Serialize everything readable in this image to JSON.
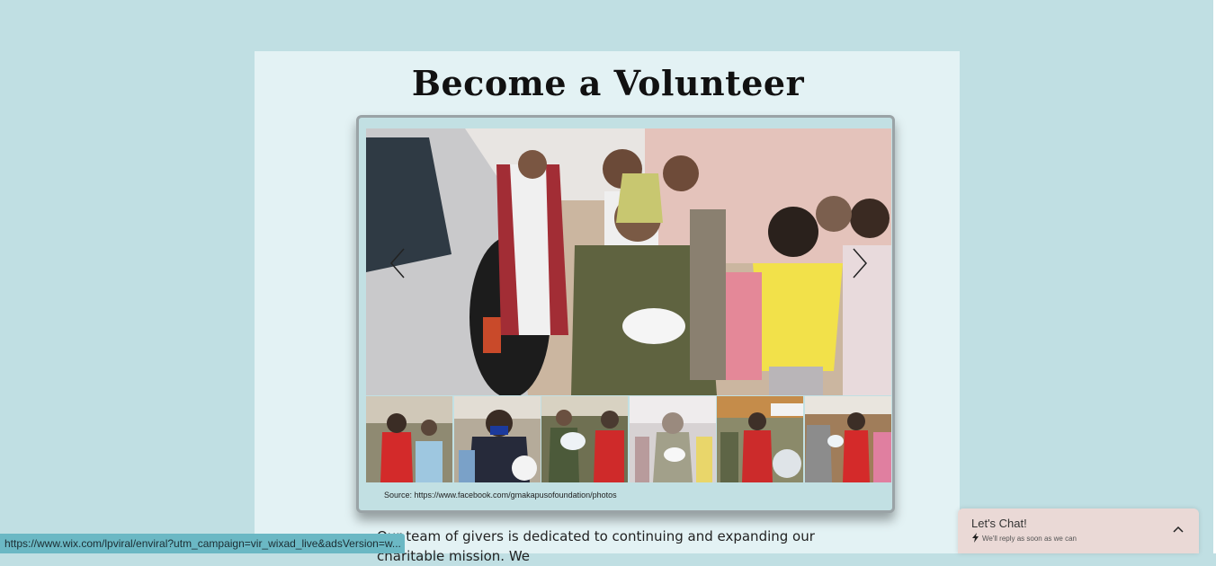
{
  "page": {
    "title": "Become a Volunteer",
    "body_text": "Our team of givers is dedicated to continuing and expanding our charitable mission. We"
  },
  "gallery": {
    "source_text": "Source: https://www.facebook.com/gmakapusofoundation/photos",
    "prev_icon": "chevron-left-icon",
    "next_icon": "chevron-right-icon",
    "thumbnail_count": 6
  },
  "status_bar": {
    "url": "https://www.wix.com/lpviral/enviral?utm_campaign=vir_wixad_live&adsVersion=w..."
  },
  "chat": {
    "title": "Let's Chat!",
    "subtitle": "We'll reply as soon as we can",
    "icon": "lightning-icon",
    "toggle_icon": "chevron-up-icon"
  },
  "colors": {
    "background": "#c0dfe3",
    "panel": "#e3f2f4",
    "chat_bg": "#ead9d6",
    "status_bg": "#6bb8c4"
  }
}
